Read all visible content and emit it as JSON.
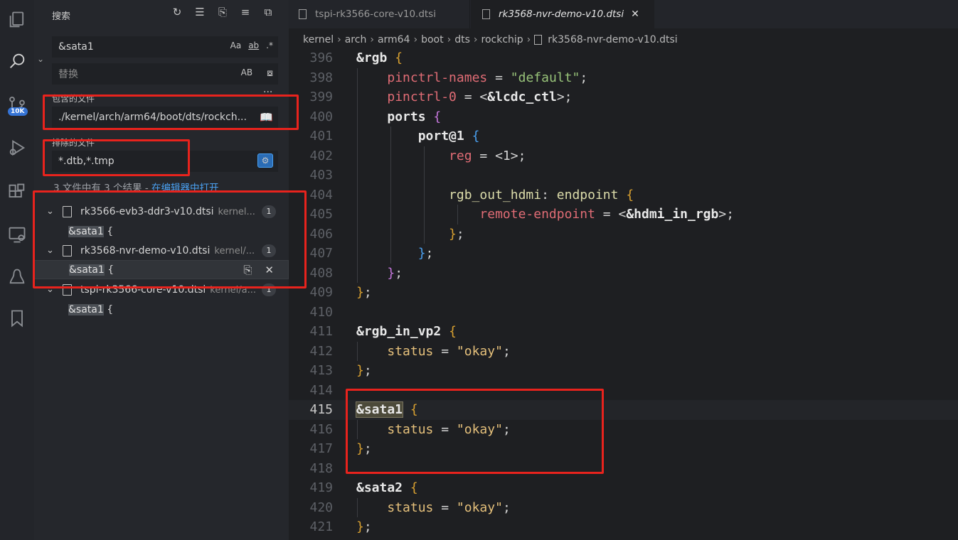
{
  "sidebar": {
    "title": "搜索",
    "search_value": "&sata1",
    "search_opts": [
      "Aa",
      "ab",
      ".*"
    ],
    "replace_placeholder": "替换",
    "replace_opt": "AB",
    "include_label": "包含的文件",
    "include_value": "./kernel/arch/arm64/boot/dts/rockch...",
    "exclude_label": "排除的文件",
    "exclude_value": "*.dtb,*.tmp",
    "summary_prefix": "3 文件中有 3 个结果 - ",
    "summary_link": "在编辑器中打开",
    "results": [
      {
        "file": "rk3566-evb3-ddr3-v10.dtsi",
        "path": "kernel...",
        "count": "1",
        "match_hl": "&sata1",
        "match_rest": " {"
      },
      {
        "file": "rk3568-nvr-demo-v10.dtsi",
        "path": "kernel/...",
        "count": "1",
        "match_hl": "&sata1",
        "match_rest": " {"
      },
      {
        "file": "tspi-rk3566-core-v10.dtsi",
        "path": "kernel/a...",
        "count": "1",
        "match_hl": "&sata1",
        "match_rest": " {"
      }
    ],
    "badge": "10K"
  },
  "tabs": [
    {
      "label": "tspi-rk3566-core-v10.dtsi"
    },
    {
      "label": "rk3568-nvr-demo-v10.dtsi",
      "close": "✕"
    }
  ],
  "breadcrumb": [
    "kernel",
    "arch",
    "arm64",
    "boot",
    "dts",
    "rockchip",
    "rk3568-nvr-demo-v10.dtsi"
  ],
  "editor": {
    "line_numbers": [
      "396",
      "398",
      "399",
      "400",
      "401",
      "402",
      "403",
      "404",
      "405",
      "406",
      "407",
      "408",
      "409",
      "410",
      "411",
      "412",
      "413",
      "414",
      "415",
      "416",
      "417",
      "418",
      "419",
      "420",
      "421"
    ],
    "current_line": "415"
  },
  "colors": {
    "accent": "#3574d6",
    "highlight_box": "#e8231d",
    "link": "#4aa0f0"
  }
}
